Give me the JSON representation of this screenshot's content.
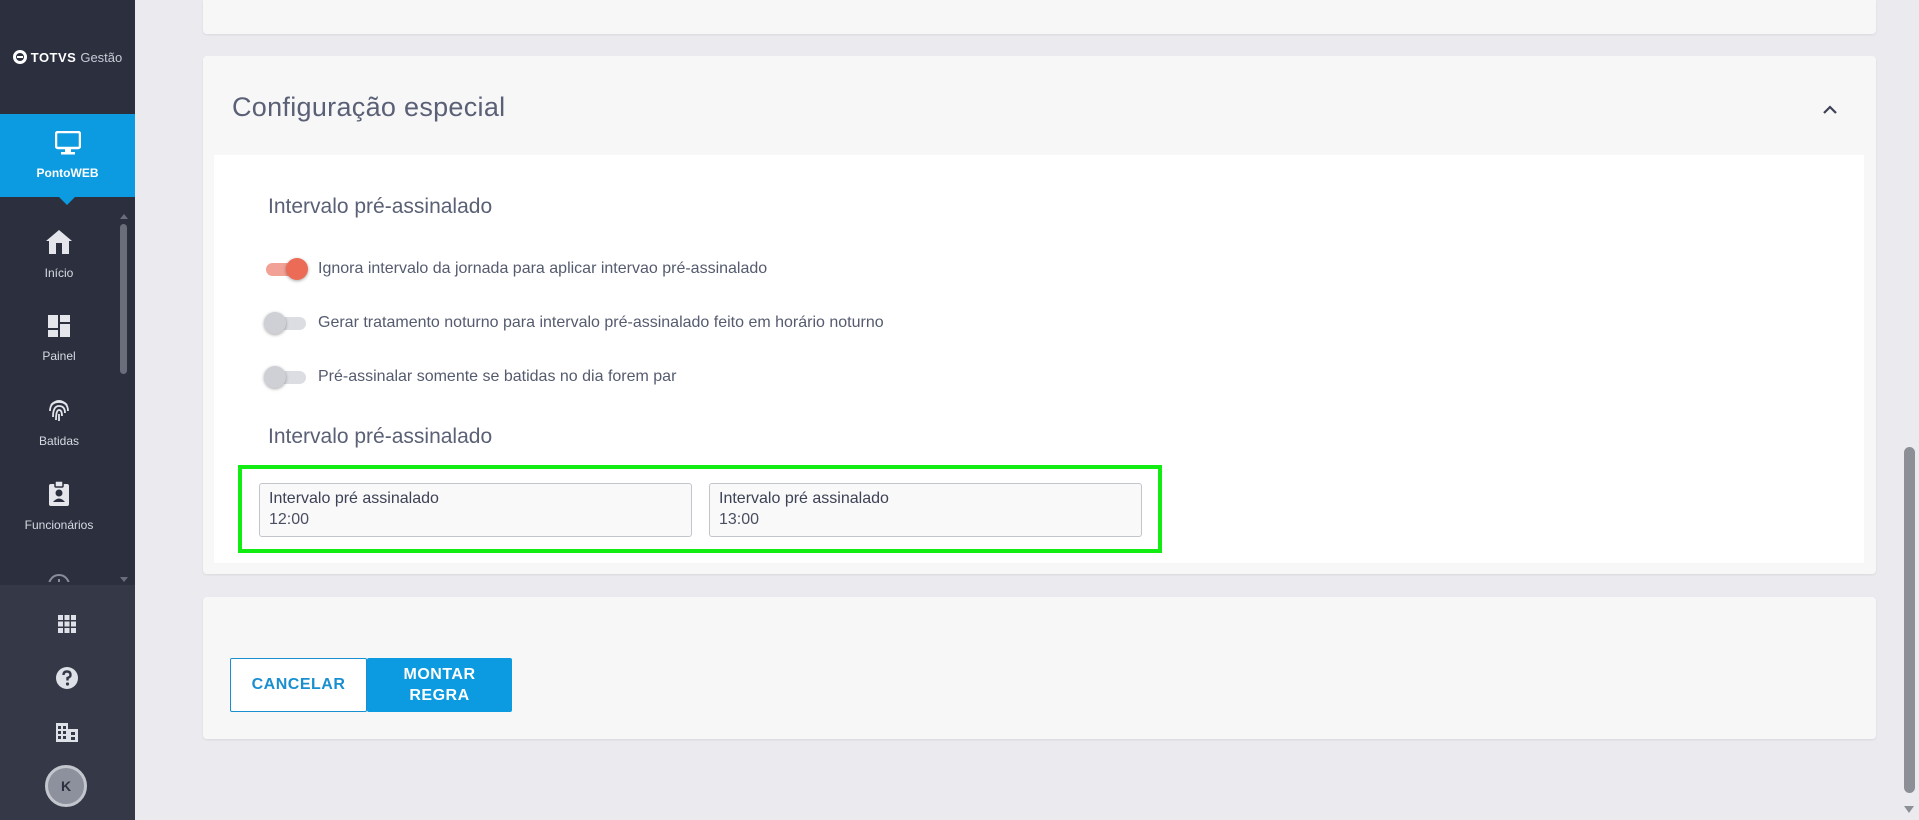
{
  "brand": {
    "name": "TOTVS",
    "product": "Gestão"
  },
  "module": {
    "label": "PontoWEB",
    "icon": "monitor-icon"
  },
  "nav": {
    "items": [
      {
        "label": "Início",
        "icon": "home-icon"
      },
      {
        "label": "Painel",
        "icon": "dashboard-icon"
      },
      {
        "label": "Batidas",
        "icon": "fingerprint-icon"
      },
      {
        "label": "Funcionários",
        "icon": "badge-icon"
      },
      {
        "label": "",
        "icon": "clock-icon"
      }
    ]
  },
  "sidebar_bottom": {
    "apps_icon": "apps-grid-icon",
    "help_icon": "help-icon",
    "company_icon": "building-icon",
    "avatar_initial": "K"
  },
  "special_config": {
    "title": "Configuração especial",
    "section1_title": "Intervalo pré-assinalado",
    "toggles": [
      {
        "label": "Ignora intervalo da jornada para aplicar intervao pré-assinalado",
        "on": true
      },
      {
        "label": "Gerar tratamento noturno para intervalo pré-assinalado feito em horário noturno",
        "on": false
      },
      {
        "label": "Pré-assinalar somente se batidas no dia forem par",
        "on": false
      }
    ],
    "section2_title": "Intervalo pré-assinalado",
    "fields": [
      {
        "label": "Intervalo pré assinalado",
        "value": "12:00"
      },
      {
        "label": "Intervalo pré assinalado",
        "value": "13:00"
      }
    ]
  },
  "actions": {
    "cancel_label": "CANCELAR",
    "primary_label": "MONTAR REGRA"
  },
  "colors": {
    "sidebar": "#2c2f3e",
    "accent": "#0c9be0",
    "toggle_on": "#ec6b56",
    "highlight": "#12ec12"
  }
}
